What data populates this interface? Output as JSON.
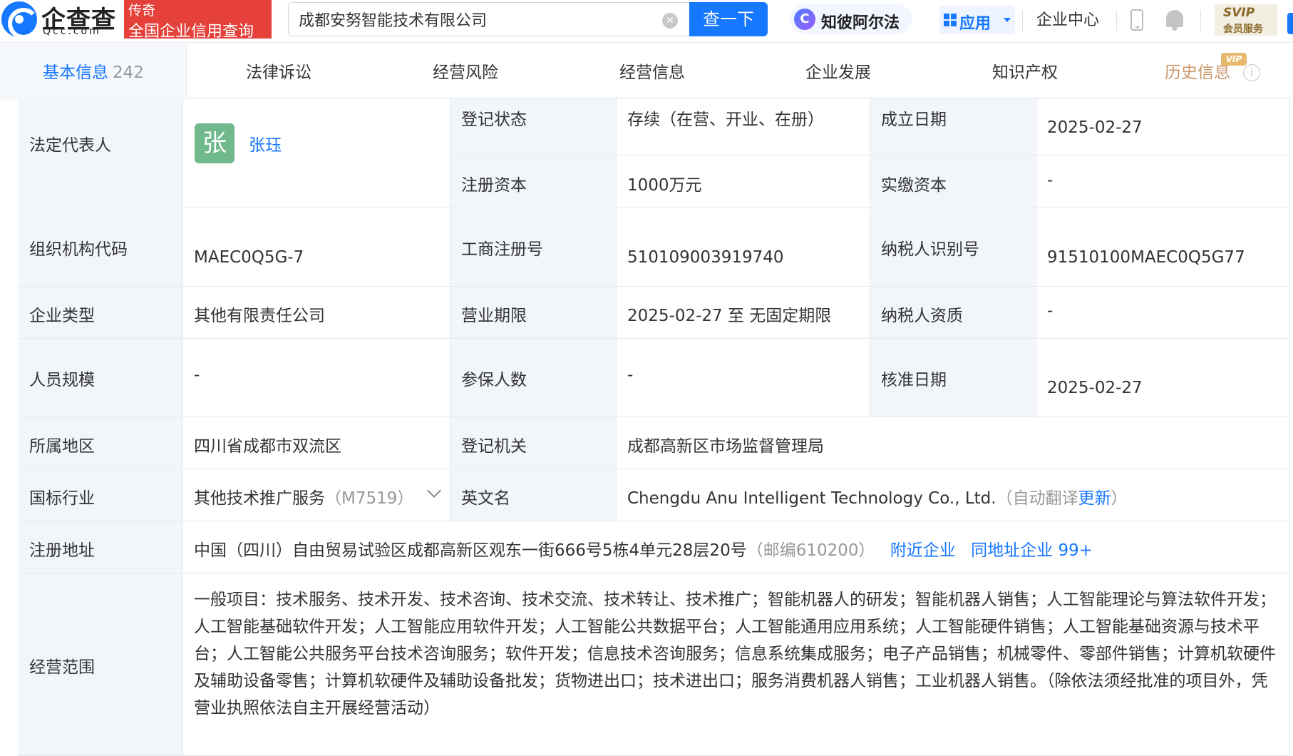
{
  "header": {
    "logo_name": "企查查",
    "logo_domain": "Qcc.com",
    "promo_line1": "传奇",
    "promo_line2": "全国企业信用查询",
    "search_value": "成都安努智能技术有限公司",
    "search_button": "查一下",
    "ai_label": "知彼阿尔法",
    "ai_icon_letter": "C",
    "apps_label": "应用",
    "corp_center": "企业中心",
    "svip_line1": "SVIP",
    "svip_line2": "会员服务",
    "accent_color": "#1677ff",
    "promo_color": "#e5403a"
  },
  "tabs": [
    {
      "label": "基本信息",
      "count": "242",
      "active": true
    },
    {
      "label": "法律诉讼"
    },
    {
      "label": "经营风险"
    },
    {
      "label": "经营信息"
    },
    {
      "label": "企业发展"
    },
    {
      "label": "知识产权"
    },
    {
      "label": "历史信息",
      "badge": "VIP"
    }
  ],
  "info": {
    "legal_rep_label": "法定代表人",
    "legal_rep_avatar": "张",
    "legal_rep_name": "张珏",
    "reg_status_label": "登记状态",
    "reg_status_value": "存续（在营、开业、在册）",
    "founded_label": "成立日期",
    "founded_value": "2025-02-27",
    "reg_capital_label": "注册资本",
    "reg_capital_value": "1000万元",
    "paid_capital_label": "实缴资本",
    "paid_capital_value": "-",
    "org_code_label": "组织机构代码",
    "org_code_value": "MAEC0Q5G-7",
    "biz_reg_no_label": "工商注册号",
    "biz_reg_no_value": "510109003919740",
    "taxpayer_id_label": "纳税人识别号",
    "taxpayer_id_value": "91510100MAEC0Q5G77",
    "company_type_label": "企业类型",
    "company_type_value": "其他有限责任公司",
    "biz_term_label": "营业期限",
    "biz_term_value": "2025-02-27 至 无固定期限",
    "taxpayer_qual_label": "纳税人资质",
    "taxpayer_qual_value": "-",
    "staff_size_label": "人员规模",
    "staff_size_value": "-",
    "insured_label": "参保人数",
    "insured_value": "-",
    "approval_date_label": "核准日期",
    "approval_date_value": "2025-02-27",
    "region_label": "所属地区",
    "region_value": "四川省成都市双流区",
    "reg_authority_label": "登记机关",
    "reg_authority_value": "成都高新区市场监督管理局",
    "industry_label": "国标行业",
    "industry_value": "其他技术推广服务",
    "industry_code": "（M7519）",
    "english_name_label": "英文名",
    "english_name_value": "Chengdu Anu Intelligent Technology Co., Ltd.",
    "english_name_note_prefix": "（自动翻译",
    "english_name_update": "更新",
    "english_name_note_suffix": "）",
    "address_label": "注册地址",
    "address_value": "中国（四川）自由贸易试验区成都高新区观东一街666号5栋4单元28层20号",
    "address_postcode": "（邮编610200）",
    "nearby_link": "附近企业",
    "same_address_link": "同地址企业 99+",
    "scope_label": "经营范围",
    "scope_value": "一般项目：技术服务、技术开发、技术咨询、技术交流、技术转让、技术推广；智能机器人的研发；智能机器人销售；人工智能理论与算法软件开发；人工智能基础软件开发；人工智能应用软件开发；人工智能公共数据平台；人工智能通用应用系统；人工智能硬件销售；人工智能基础资源与技术平台；人工智能公共服务平台技术咨询服务；软件开发；信息技术咨询服务；信息系统集成服务；电子产品销售；机械零件、零部件销售；计算机软硬件及辅助设备零售；计算机软硬件及辅助设备批发；货物进出口；技术进出口；服务消费机器人销售；工业机器人销售。（除依法须经批准的项目外，凭营业执照依法自主开展经营活动）"
  }
}
